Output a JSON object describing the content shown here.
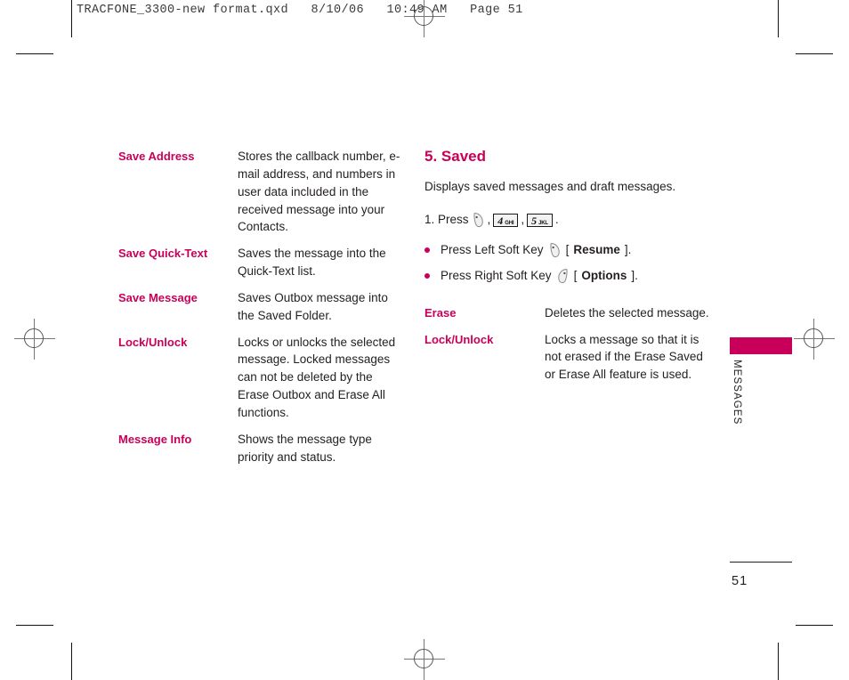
{
  "prepress": {
    "header": "TRACFONE_3300-new format.qxd   8/10/06   10:49 AM   Page 51"
  },
  "left_column": {
    "rows": [
      {
        "term": "Save Address",
        "description": "Stores the callback number, e-mail address, and numbers in user data included in the received message into your Contacts."
      },
      {
        "term": "Save Quick-Text",
        "description": "Saves the message into the Quick-Text list."
      },
      {
        "term": "Save Message",
        "description": "Saves Outbox message into the Saved Folder."
      },
      {
        "term": "Lock/Unlock",
        "description": "Locks or unlocks the selected message. Locked messages can not be deleted by the Erase Outbox and Erase All functions."
      },
      {
        "term": "Message Info",
        "description": "Shows the message type priority and status."
      }
    ]
  },
  "right_column": {
    "heading": "5. Saved",
    "intro": "Displays saved messages and draft messages.",
    "step": {
      "number": "1. Press",
      "comma1": ",",
      "comma2": ",",
      "period": ".",
      "key1_digit": "4",
      "key1_letters": "GHI",
      "key2_digit": "5",
      "key2_letters": "JKL"
    },
    "bullets": [
      {
        "text_before": "Press Left Soft Key",
        "bracket_open": "[",
        "label": "Resume",
        "bracket_close": "].",
        "icon": "left-soft-key-icon"
      },
      {
        "text_before": "Press Right Soft Key",
        "bracket_open": "[",
        "label": "Options",
        "bracket_close": "].",
        "icon": "right-soft-key-icon"
      }
    ],
    "rows": [
      {
        "term": "Erase",
        "description": "Deletes the selected message."
      },
      {
        "term": "Lock/Unlock",
        "description": "Locks a message so that it is not erased if the Erase Saved or Erase All feature is used."
      }
    ]
  },
  "side_tab": {
    "label": "MESSAGES"
  },
  "folio": {
    "page_number": "51"
  },
  "colors": {
    "accent": "#c8005a",
    "body_text": "#231f20"
  }
}
